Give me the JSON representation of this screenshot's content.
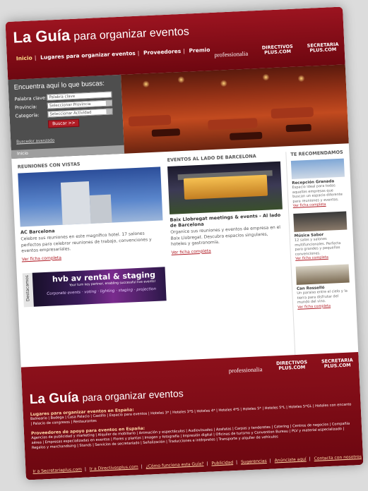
{
  "brand": {
    "name": "La Guía",
    "tagline": "para organizar eventos"
  },
  "nav": [
    {
      "label": "Inicio",
      "active": true
    },
    {
      "label": "Lugares para organizar eventos",
      "active": false
    },
    {
      "label": "Proveedores",
      "active": false
    },
    {
      "label": "Premio",
      "active": false
    }
  ],
  "partners": [
    {
      "line1": "professionalia",
      "line2": ""
    },
    {
      "line1": "DIRECTIVOS",
      "line2": "PLUS.COM"
    },
    {
      "line1": "SECRETARIA",
      "line2": "PLUS.COM"
    }
  ],
  "search": {
    "title": "Encuentra aquí lo que buscas:",
    "keyword_label": "Palabra clave:",
    "keyword_placeholder": "Palabra clave",
    "province_label": "Provincia:",
    "province_value": "Seleccionar Provincia",
    "category_label": "Categoría:",
    "category_value": "Seleccionar Actividad",
    "button": "Buscar >>",
    "advanced": "Buscador avanzado",
    "breadcrumb": "Inicio"
  },
  "sections": {
    "views": {
      "heading": "REUNIONES CON VISTAS",
      "title": "AC Barcelona",
      "desc": "Celebre sus reuniones en este magnífico hotel. 17 salones perfectos para celebrar reuniones de trabajo, convenciones y eventos empresariales.",
      "more": "Ver ficha completa"
    },
    "barcelona": {
      "heading": "EVENTOS AL LADO DE BARCELONA",
      "title": "Baix Llobregat meetings & events - Al lado de Barcelona",
      "desc": "Organice sus reuniones y eventos de empresa en el Baix Llobregat. Descubra espacios singulares, hoteles y gastronomía.",
      "more": "Ver ficha completa"
    },
    "featured_label": "Destacamos",
    "ad": {
      "headline": "hvb av rental & staging",
      "tagline": "Your turn key partner, enabling successful live events!",
      "services": "Corporate events · voting · lighting · staging · projection"
    },
    "recommended": {
      "heading": "TE RECOMENDAMOS",
      "items": [
        {
          "title": "Recepción Granada",
          "desc": "Espacio ideal para todas aquellas empresas que buscan un espacio diferente para reuniones y eventos.",
          "more": "Ver ficha completa"
        },
        {
          "title": "Música Sabor",
          "desc": "12 salas y salones multifuncionales. Perfecta para grandes y pequeñas convenciones.",
          "more": "Ver ficha completa"
        },
        {
          "title": "Can Rosselló",
          "desc": "Un paraíso entre el cielo y la tierra para disfrutar del mundo del vino.",
          "more": "Ver ficha completa"
        }
      ]
    }
  },
  "footer": {
    "places_heading": "Lugares para organizar eventos en España:",
    "places_links": "Balneario | Bodega | Casa Palacio | Castillo | Espacio para eventos | Hoteles 3* | Hoteles 3*S | Hoteles 4* | Hoteles 4*S | Hoteles 5* | Hoteles 5*L | Hoteles 5*GL | Hoteles con encanto | Palacio de congresos | Restaurantes",
    "suppliers_heading": "Proveedores de apoyo para eventos en España:",
    "suppliers_links": "Agencias de publicidad y marketing | Alquiler de mobiliario | Animación y espectáculos | Audiovisuales | Azafatas | Carpas y tenderetes | Catering | Centros de negocios | Compañía aérea | Empresas especializadas en eventos | Flores y plantas | Imagen y fotografía | Impresión digital | Oficinas de turismo y Convention Bureau | PLV y material especializado | Regalos y merchandising | Stands | Servicios de secretariado | Señalización | Traducciones e intérpretes | Transporte y alquiler de vehículos",
    "bottom_links": [
      "Ir a Secretariaplus.com",
      "Ir a Directivosplus.com",
      "¿Cómo funciona esta Guía?",
      "Publicidad",
      "Sugerencias",
      "Anúnciate aquí",
      "Contacta con nosotros"
    ]
  },
  "colors": {
    "brand_red": "#8c101b",
    "link_red": "#b01c25",
    "panel_gray": "#4e4e4e"
  }
}
